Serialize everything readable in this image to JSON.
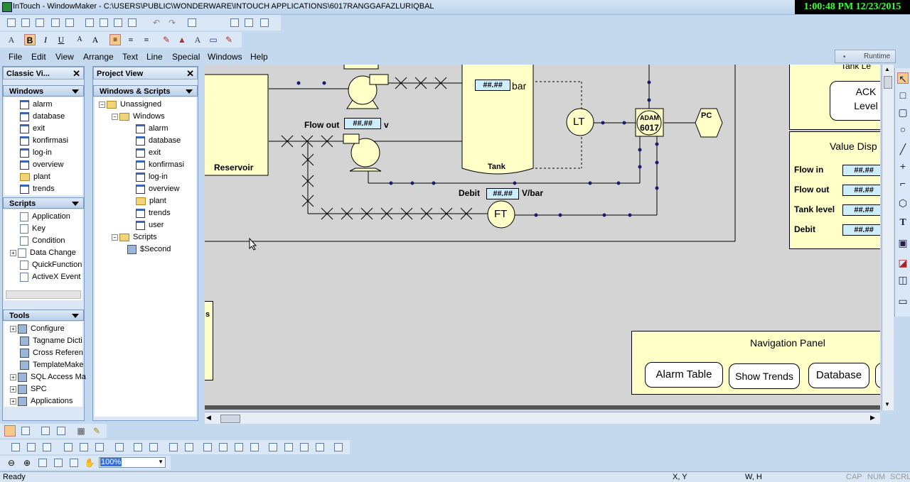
{
  "titlebar": {
    "title": "InTouch - WindowMaker - C:\\USERS\\PUBLIC\\WONDERWARE\\INTOUCH APPLICATIONS\\6017RANGGAFAZLURIQBAL",
    "clock": "1:00:48 PM 12/23/2015"
  },
  "menu": [
    "File",
    "Edit",
    "View",
    "Arrange",
    "Text",
    "Line",
    "Special",
    "Windows",
    "Help"
  ],
  "runtime_label": "Runtime",
  "classic_view": {
    "title": "Classic Vi...",
    "windows_header": "Windows",
    "windows": [
      "alarm",
      "database",
      "exit",
      "konfirmasi",
      "log-in",
      "overview",
      "plant",
      "trends"
    ],
    "scripts_header": "Scripts",
    "scripts": [
      "Application",
      "Key",
      "Condition",
      "Data Change",
      "QuickFunction",
      "ActiveX Event"
    ],
    "tools_header": "Tools",
    "tools": [
      "Configure",
      "Tagname Dicti",
      "Cross Referen",
      "TemplateMake",
      "SQL Access Ma",
      "SPC",
      "Applications"
    ]
  },
  "project_view": {
    "title": "Project View",
    "section": "Windows & Scripts",
    "root": "Unassigned",
    "windows_folder": "Windows",
    "windows": [
      "alarm",
      "database",
      "exit",
      "konfirmasi",
      "log-in",
      "overview",
      "plant",
      "trends",
      "user"
    ],
    "scripts_folder": "Scripts",
    "scripts": [
      "$Second"
    ]
  },
  "canvas": {
    "reservoir": "Reservoir",
    "tank": "Tank",
    "tank_field": "##.##",
    "tank_unit": "bar",
    "flow_out_label": "Flow out",
    "flow_out_field": "##.##",
    "flow_out_unit": "v",
    "debit_label": "Debit",
    "debit_field": "##.##",
    "debit_unit": "V/bar",
    "lt": "LT",
    "ft": "FT",
    "adam": "ADAM",
    "adam_num": "6017",
    "pc": "PC",
    "ack": "ACK",
    "level": "Level",
    "tank_le": "Tank Le",
    "value_disp_title": "Value Disp",
    "value_rows": [
      {
        "label": "Flow in",
        "field": "##.##"
      },
      {
        "label": "Flow out",
        "field": "##.##"
      },
      {
        "label": "Tank level",
        "field": "##.##"
      },
      {
        "label": "Debit",
        "field": "##.##"
      }
    ],
    "nav_title": "Navigation Panel",
    "nav_buttons": [
      "Alarm Table",
      "Show Trends",
      "Database"
    ],
    "left_fragment": "s"
  },
  "zoom": "100%",
  "status": {
    "ready": "Ready",
    "xy": "X, Y",
    "wh": "W, H",
    "cap": "CAP",
    "num": "NUM",
    "scrl": "SCRL"
  }
}
